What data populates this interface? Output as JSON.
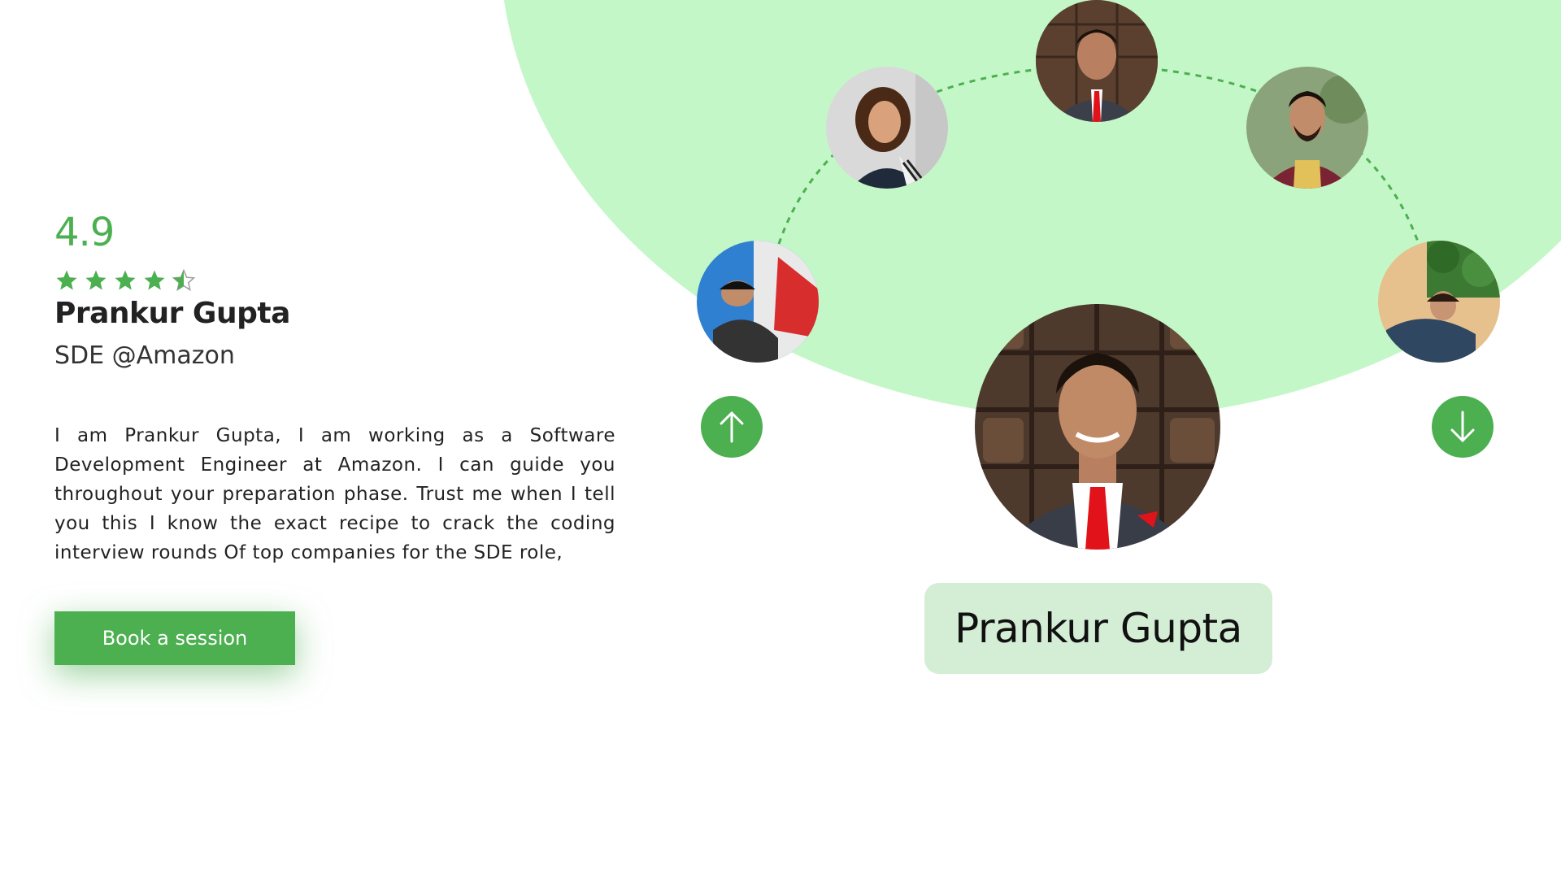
{
  "profile": {
    "rating": "4.9",
    "stars": 4.5,
    "name": "Prankur Gupta",
    "role": "SDE @Amazon",
    "bio": "I am Prankur Gupta, I am working as a Software Development Engineer at Amazon. I can guide you throughout your preparation phase. Trust me when I tell you this I know the exact recipe to crack the coding interview rounds Of top companies for the SDE role,",
    "cta_label": "Book a session"
  },
  "carousel": {
    "selected_name": "Prankur Gupta",
    "prev_icon": "arrow-up-icon",
    "next_icon": "arrow-down-icon"
  },
  "colors": {
    "accent": "#4caf50",
    "blob": "#c4f7c7",
    "name_card": "#d4edd5"
  }
}
